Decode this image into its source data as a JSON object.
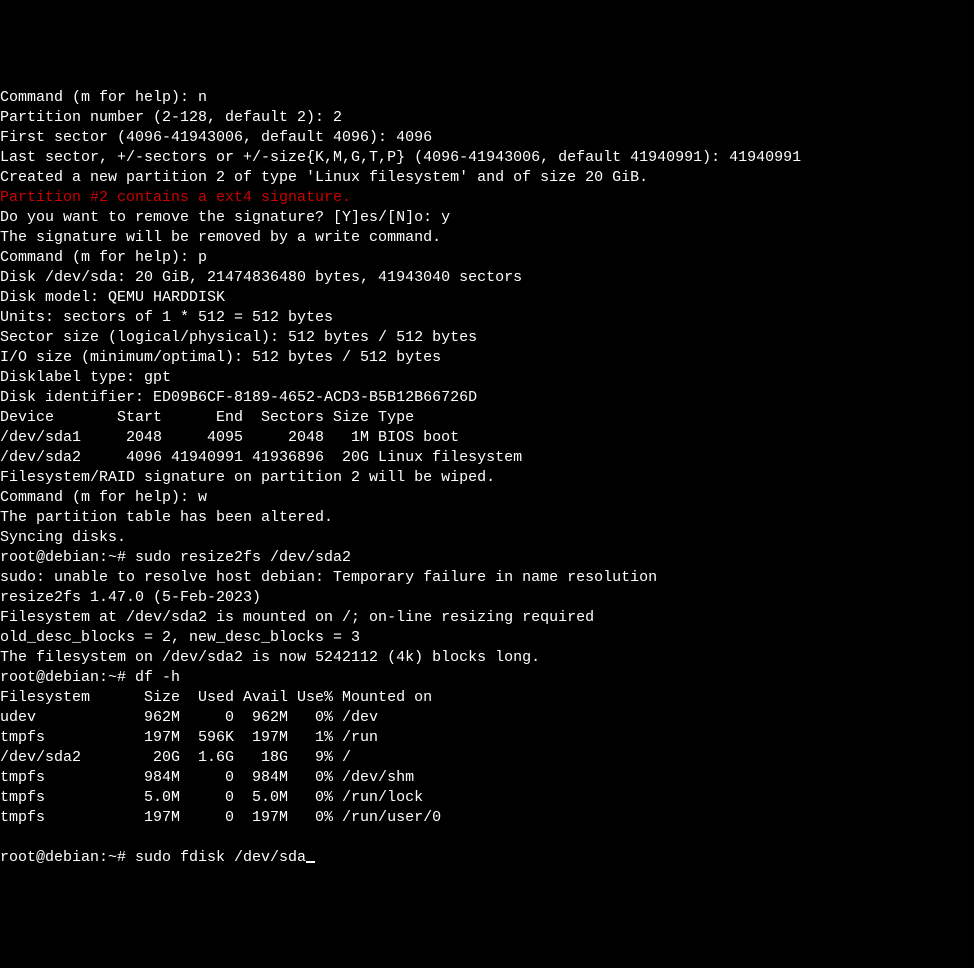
{
  "lines": [
    {
      "text": "Command (m for help): n",
      "class": ""
    },
    {
      "text": "Partition number (2-128, default 2): 2",
      "class": ""
    },
    {
      "text": "First sector (4096-41943006, default 4096): 4096",
      "class": ""
    },
    {
      "text": "Last sector, +/-sectors or +/-size{K,M,G,T,P} (4096-41943006, default 41940991): 41940991",
      "class": ""
    },
    {
      "text": "",
      "class": ""
    },
    {
      "text": "Created a new partition 2 of type 'Linux filesystem' and of size 20 GiB.",
      "class": ""
    },
    {
      "text": "Partition #2 contains a ext4 signature.",
      "class": "red"
    },
    {
      "text": "",
      "class": ""
    },
    {
      "text": "Do you want to remove the signature? [Y]es/[N]o: y",
      "class": ""
    },
    {
      "text": "",
      "class": ""
    },
    {
      "text": "The signature will be removed by a write command.",
      "class": ""
    },
    {
      "text": "",
      "class": ""
    },
    {
      "text": "Command (m for help): p",
      "class": ""
    },
    {
      "text": "Disk /dev/sda: 20 GiB, 21474836480 bytes, 41943040 sectors",
      "class": ""
    },
    {
      "text": "Disk model: QEMU HARDDISK",
      "class": ""
    },
    {
      "text": "Units: sectors of 1 * 512 = 512 bytes",
      "class": ""
    },
    {
      "text": "Sector size (logical/physical): 512 bytes / 512 bytes",
      "class": ""
    },
    {
      "text": "I/O size (minimum/optimal): 512 bytes / 512 bytes",
      "class": ""
    },
    {
      "text": "Disklabel type: gpt",
      "class": ""
    },
    {
      "text": "Disk identifier: ED09B6CF-8189-4652-ACD3-B5B12B66726D",
      "class": ""
    },
    {
      "text": "",
      "class": ""
    },
    {
      "text": "Device       Start      End  Sectors Size Type",
      "class": ""
    },
    {
      "text": "/dev/sda1     2048     4095     2048   1M BIOS boot",
      "class": ""
    },
    {
      "text": "/dev/sda2     4096 41940991 41936896  20G Linux filesystem",
      "class": ""
    },
    {
      "text": "",
      "class": ""
    },
    {
      "text": "Filesystem/RAID signature on partition 2 will be wiped.",
      "class": ""
    },
    {
      "text": "",
      "class": ""
    },
    {
      "text": "Command (m for help): w",
      "class": ""
    },
    {
      "text": "The partition table has been altered.",
      "class": ""
    },
    {
      "text": "Syncing disks.",
      "class": ""
    },
    {
      "text": "",
      "class": ""
    },
    {
      "text": "root@debian:~# sudo resize2fs /dev/sda2",
      "class": ""
    },
    {
      "text": "sudo: unable to resolve host debian: Temporary failure in name resolution",
      "class": ""
    },
    {
      "text": "resize2fs 1.47.0 (5-Feb-2023)",
      "class": ""
    },
    {
      "text": "Filesystem at /dev/sda2 is mounted on /; on-line resizing required",
      "class": ""
    },
    {
      "text": "old_desc_blocks = 2, new_desc_blocks = 3",
      "class": ""
    },
    {
      "text": "The filesystem on /dev/sda2 is now 5242112 (4k) blocks long.",
      "class": ""
    },
    {
      "text": "",
      "class": ""
    },
    {
      "text": "root@debian:~# df -h",
      "class": ""
    },
    {
      "text": "Filesystem      Size  Used Avail Use% Mounted on",
      "class": ""
    },
    {
      "text": "udev            962M     0  962M   0% /dev",
      "class": ""
    },
    {
      "text": "tmpfs           197M  596K  197M   1% /run",
      "class": ""
    },
    {
      "text": "/dev/sda2        20G  1.6G   18G   9% /",
      "class": ""
    },
    {
      "text": "tmpfs           984M     0  984M   0% /dev/shm",
      "class": ""
    },
    {
      "text": "tmpfs           5.0M     0  5.0M   0% /run/lock",
      "class": ""
    },
    {
      "text": "tmpfs           197M     0  197M   0% /run/user/0",
      "class": ""
    }
  ],
  "prompt_line": "root@debian:~# sudo fdisk /dev/sda"
}
